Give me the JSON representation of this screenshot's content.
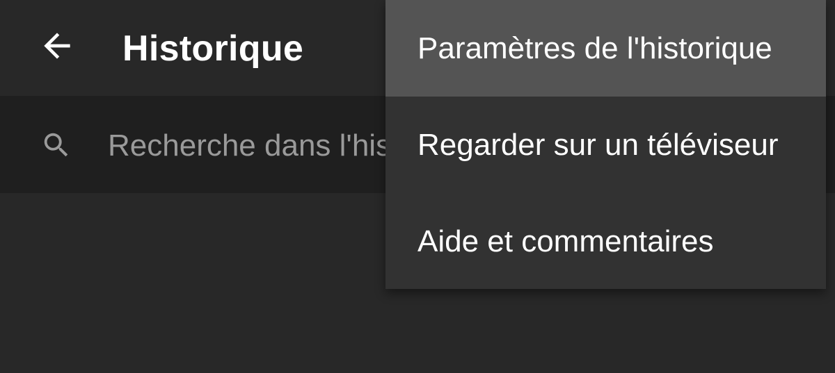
{
  "header": {
    "title": "Historique",
    "back_icon": "arrow-left-icon"
  },
  "search": {
    "icon": "search-icon",
    "placeholder": "Recherche dans l'historique"
  },
  "menu": {
    "items": [
      {
        "label": "Paramètres de l'historique",
        "highlighted": true
      },
      {
        "label": "Regarder sur un téléviseur",
        "highlighted": false
      },
      {
        "label": "Aide et commentaires",
        "highlighted": false
      }
    ]
  },
  "colors": {
    "background": "#282828",
    "search_bar": "#1f1f1f",
    "menu_background": "#323232",
    "menu_highlight": "#545454",
    "text_primary": "#ffffff",
    "text_secondary": "#9a9a9a"
  }
}
